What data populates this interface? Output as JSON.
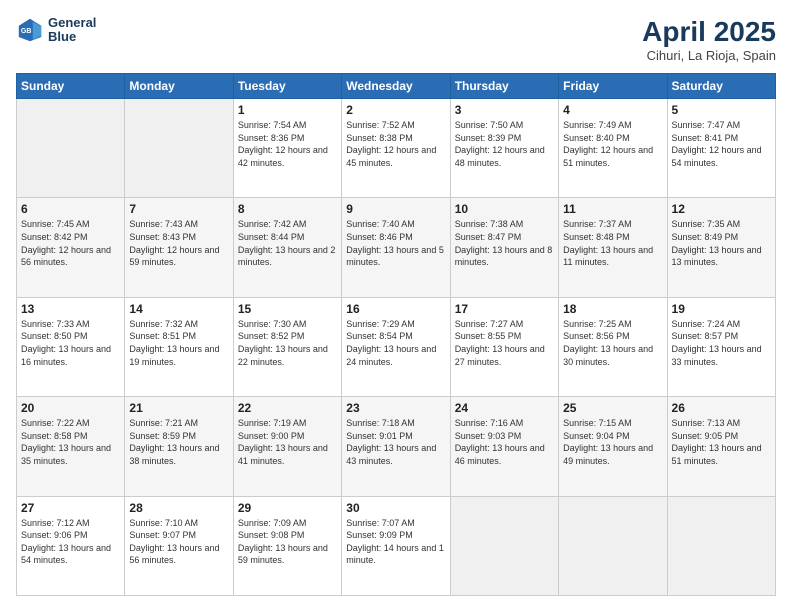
{
  "header": {
    "logo_line1": "General",
    "logo_line2": "Blue",
    "title": "April 2025",
    "subtitle": "Cihuri, La Rioja, Spain"
  },
  "days_of_week": [
    "Sunday",
    "Monday",
    "Tuesday",
    "Wednesday",
    "Thursday",
    "Friday",
    "Saturday"
  ],
  "weeks": [
    [
      {
        "day": null
      },
      {
        "day": null
      },
      {
        "day": "1",
        "sunrise": "Sunrise: 7:54 AM",
        "sunset": "Sunset: 8:36 PM",
        "daylight": "Daylight: 12 hours and 42 minutes."
      },
      {
        "day": "2",
        "sunrise": "Sunrise: 7:52 AM",
        "sunset": "Sunset: 8:38 PM",
        "daylight": "Daylight: 12 hours and 45 minutes."
      },
      {
        "day": "3",
        "sunrise": "Sunrise: 7:50 AM",
        "sunset": "Sunset: 8:39 PM",
        "daylight": "Daylight: 12 hours and 48 minutes."
      },
      {
        "day": "4",
        "sunrise": "Sunrise: 7:49 AM",
        "sunset": "Sunset: 8:40 PM",
        "daylight": "Daylight: 12 hours and 51 minutes."
      },
      {
        "day": "5",
        "sunrise": "Sunrise: 7:47 AM",
        "sunset": "Sunset: 8:41 PM",
        "daylight": "Daylight: 12 hours and 54 minutes."
      }
    ],
    [
      {
        "day": "6",
        "sunrise": "Sunrise: 7:45 AM",
        "sunset": "Sunset: 8:42 PM",
        "daylight": "Daylight: 12 hours and 56 minutes."
      },
      {
        "day": "7",
        "sunrise": "Sunrise: 7:43 AM",
        "sunset": "Sunset: 8:43 PM",
        "daylight": "Daylight: 12 hours and 59 minutes."
      },
      {
        "day": "8",
        "sunrise": "Sunrise: 7:42 AM",
        "sunset": "Sunset: 8:44 PM",
        "daylight": "Daylight: 13 hours and 2 minutes."
      },
      {
        "day": "9",
        "sunrise": "Sunrise: 7:40 AM",
        "sunset": "Sunset: 8:46 PM",
        "daylight": "Daylight: 13 hours and 5 minutes."
      },
      {
        "day": "10",
        "sunrise": "Sunrise: 7:38 AM",
        "sunset": "Sunset: 8:47 PM",
        "daylight": "Daylight: 13 hours and 8 minutes."
      },
      {
        "day": "11",
        "sunrise": "Sunrise: 7:37 AM",
        "sunset": "Sunset: 8:48 PM",
        "daylight": "Daylight: 13 hours and 11 minutes."
      },
      {
        "day": "12",
        "sunrise": "Sunrise: 7:35 AM",
        "sunset": "Sunset: 8:49 PM",
        "daylight": "Daylight: 13 hours and 13 minutes."
      }
    ],
    [
      {
        "day": "13",
        "sunrise": "Sunrise: 7:33 AM",
        "sunset": "Sunset: 8:50 PM",
        "daylight": "Daylight: 13 hours and 16 minutes."
      },
      {
        "day": "14",
        "sunrise": "Sunrise: 7:32 AM",
        "sunset": "Sunset: 8:51 PM",
        "daylight": "Daylight: 13 hours and 19 minutes."
      },
      {
        "day": "15",
        "sunrise": "Sunrise: 7:30 AM",
        "sunset": "Sunset: 8:52 PM",
        "daylight": "Daylight: 13 hours and 22 minutes."
      },
      {
        "day": "16",
        "sunrise": "Sunrise: 7:29 AM",
        "sunset": "Sunset: 8:54 PM",
        "daylight": "Daylight: 13 hours and 24 minutes."
      },
      {
        "day": "17",
        "sunrise": "Sunrise: 7:27 AM",
        "sunset": "Sunset: 8:55 PM",
        "daylight": "Daylight: 13 hours and 27 minutes."
      },
      {
        "day": "18",
        "sunrise": "Sunrise: 7:25 AM",
        "sunset": "Sunset: 8:56 PM",
        "daylight": "Daylight: 13 hours and 30 minutes."
      },
      {
        "day": "19",
        "sunrise": "Sunrise: 7:24 AM",
        "sunset": "Sunset: 8:57 PM",
        "daylight": "Daylight: 13 hours and 33 minutes."
      }
    ],
    [
      {
        "day": "20",
        "sunrise": "Sunrise: 7:22 AM",
        "sunset": "Sunset: 8:58 PM",
        "daylight": "Daylight: 13 hours and 35 minutes."
      },
      {
        "day": "21",
        "sunrise": "Sunrise: 7:21 AM",
        "sunset": "Sunset: 8:59 PM",
        "daylight": "Daylight: 13 hours and 38 minutes."
      },
      {
        "day": "22",
        "sunrise": "Sunrise: 7:19 AM",
        "sunset": "Sunset: 9:00 PM",
        "daylight": "Daylight: 13 hours and 41 minutes."
      },
      {
        "day": "23",
        "sunrise": "Sunrise: 7:18 AM",
        "sunset": "Sunset: 9:01 PM",
        "daylight": "Daylight: 13 hours and 43 minutes."
      },
      {
        "day": "24",
        "sunrise": "Sunrise: 7:16 AM",
        "sunset": "Sunset: 9:03 PM",
        "daylight": "Daylight: 13 hours and 46 minutes."
      },
      {
        "day": "25",
        "sunrise": "Sunrise: 7:15 AM",
        "sunset": "Sunset: 9:04 PM",
        "daylight": "Daylight: 13 hours and 49 minutes."
      },
      {
        "day": "26",
        "sunrise": "Sunrise: 7:13 AM",
        "sunset": "Sunset: 9:05 PM",
        "daylight": "Daylight: 13 hours and 51 minutes."
      }
    ],
    [
      {
        "day": "27",
        "sunrise": "Sunrise: 7:12 AM",
        "sunset": "Sunset: 9:06 PM",
        "daylight": "Daylight: 13 hours and 54 minutes."
      },
      {
        "day": "28",
        "sunrise": "Sunrise: 7:10 AM",
        "sunset": "Sunset: 9:07 PM",
        "daylight": "Daylight: 13 hours and 56 minutes."
      },
      {
        "day": "29",
        "sunrise": "Sunrise: 7:09 AM",
        "sunset": "Sunset: 9:08 PM",
        "daylight": "Daylight: 13 hours and 59 minutes."
      },
      {
        "day": "30",
        "sunrise": "Sunrise: 7:07 AM",
        "sunset": "Sunset: 9:09 PM",
        "daylight": "Daylight: 14 hours and 1 minute."
      },
      {
        "day": null
      },
      {
        "day": null
      },
      {
        "day": null
      }
    ]
  ]
}
